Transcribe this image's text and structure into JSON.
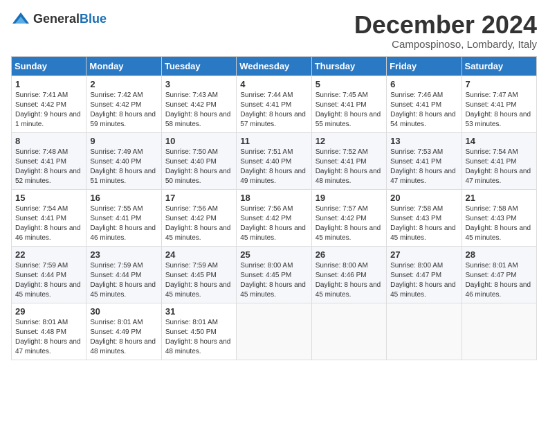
{
  "logo": {
    "general": "General",
    "blue": "Blue"
  },
  "header": {
    "month": "December 2024",
    "location": "Campospinoso, Lombardy, Italy"
  },
  "weekdays": [
    "Sunday",
    "Monday",
    "Tuesday",
    "Wednesday",
    "Thursday",
    "Friday",
    "Saturday"
  ],
  "weeks": [
    [
      {
        "day": "1",
        "sunrise": "Sunrise: 7:41 AM",
        "sunset": "Sunset: 4:42 PM",
        "daylight": "Daylight: 9 hours and 1 minute."
      },
      {
        "day": "2",
        "sunrise": "Sunrise: 7:42 AM",
        "sunset": "Sunset: 4:42 PM",
        "daylight": "Daylight: 8 hours and 59 minutes."
      },
      {
        "day": "3",
        "sunrise": "Sunrise: 7:43 AM",
        "sunset": "Sunset: 4:42 PM",
        "daylight": "Daylight: 8 hours and 58 minutes."
      },
      {
        "day": "4",
        "sunrise": "Sunrise: 7:44 AM",
        "sunset": "Sunset: 4:41 PM",
        "daylight": "Daylight: 8 hours and 57 minutes."
      },
      {
        "day": "5",
        "sunrise": "Sunrise: 7:45 AM",
        "sunset": "Sunset: 4:41 PM",
        "daylight": "Daylight: 8 hours and 55 minutes."
      },
      {
        "day": "6",
        "sunrise": "Sunrise: 7:46 AM",
        "sunset": "Sunset: 4:41 PM",
        "daylight": "Daylight: 8 hours and 54 minutes."
      },
      {
        "day": "7",
        "sunrise": "Sunrise: 7:47 AM",
        "sunset": "Sunset: 4:41 PM",
        "daylight": "Daylight: 8 hours and 53 minutes."
      }
    ],
    [
      {
        "day": "8",
        "sunrise": "Sunrise: 7:48 AM",
        "sunset": "Sunset: 4:41 PM",
        "daylight": "Daylight: 8 hours and 52 minutes."
      },
      {
        "day": "9",
        "sunrise": "Sunrise: 7:49 AM",
        "sunset": "Sunset: 4:40 PM",
        "daylight": "Daylight: 8 hours and 51 minutes."
      },
      {
        "day": "10",
        "sunrise": "Sunrise: 7:50 AM",
        "sunset": "Sunset: 4:40 PM",
        "daylight": "Daylight: 8 hours and 50 minutes."
      },
      {
        "day": "11",
        "sunrise": "Sunrise: 7:51 AM",
        "sunset": "Sunset: 4:40 PM",
        "daylight": "Daylight: 8 hours and 49 minutes."
      },
      {
        "day": "12",
        "sunrise": "Sunrise: 7:52 AM",
        "sunset": "Sunset: 4:41 PM",
        "daylight": "Daylight: 8 hours and 48 minutes."
      },
      {
        "day": "13",
        "sunrise": "Sunrise: 7:53 AM",
        "sunset": "Sunset: 4:41 PM",
        "daylight": "Daylight: 8 hours and 47 minutes."
      },
      {
        "day": "14",
        "sunrise": "Sunrise: 7:54 AM",
        "sunset": "Sunset: 4:41 PM",
        "daylight": "Daylight: 8 hours and 47 minutes."
      }
    ],
    [
      {
        "day": "15",
        "sunrise": "Sunrise: 7:54 AM",
        "sunset": "Sunset: 4:41 PM",
        "daylight": "Daylight: 8 hours and 46 minutes."
      },
      {
        "day": "16",
        "sunrise": "Sunrise: 7:55 AM",
        "sunset": "Sunset: 4:41 PM",
        "daylight": "Daylight: 8 hours and 46 minutes."
      },
      {
        "day": "17",
        "sunrise": "Sunrise: 7:56 AM",
        "sunset": "Sunset: 4:42 PM",
        "daylight": "Daylight: 8 hours and 45 minutes."
      },
      {
        "day": "18",
        "sunrise": "Sunrise: 7:56 AM",
        "sunset": "Sunset: 4:42 PM",
        "daylight": "Daylight: 8 hours and 45 minutes."
      },
      {
        "day": "19",
        "sunrise": "Sunrise: 7:57 AM",
        "sunset": "Sunset: 4:42 PM",
        "daylight": "Daylight: 8 hours and 45 minutes."
      },
      {
        "day": "20",
        "sunrise": "Sunrise: 7:58 AM",
        "sunset": "Sunset: 4:43 PM",
        "daylight": "Daylight: 8 hours and 45 minutes."
      },
      {
        "day": "21",
        "sunrise": "Sunrise: 7:58 AM",
        "sunset": "Sunset: 4:43 PM",
        "daylight": "Daylight: 8 hours and 45 minutes."
      }
    ],
    [
      {
        "day": "22",
        "sunrise": "Sunrise: 7:59 AM",
        "sunset": "Sunset: 4:44 PM",
        "daylight": "Daylight: 8 hours and 45 minutes."
      },
      {
        "day": "23",
        "sunrise": "Sunrise: 7:59 AM",
        "sunset": "Sunset: 4:44 PM",
        "daylight": "Daylight: 8 hours and 45 minutes."
      },
      {
        "day": "24",
        "sunrise": "Sunrise: 7:59 AM",
        "sunset": "Sunset: 4:45 PM",
        "daylight": "Daylight: 8 hours and 45 minutes."
      },
      {
        "day": "25",
        "sunrise": "Sunrise: 8:00 AM",
        "sunset": "Sunset: 4:45 PM",
        "daylight": "Daylight: 8 hours and 45 minutes."
      },
      {
        "day": "26",
        "sunrise": "Sunrise: 8:00 AM",
        "sunset": "Sunset: 4:46 PM",
        "daylight": "Daylight: 8 hours and 45 minutes."
      },
      {
        "day": "27",
        "sunrise": "Sunrise: 8:00 AM",
        "sunset": "Sunset: 4:47 PM",
        "daylight": "Daylight: 8 hours and 45 minutes."
      },
      {
        "day": "28",
        "sunrise": "Sunrise: 8:01 AM",
        "sunset": "Sunset: 4:47 PM",
        "daylight": "Daylight: 8 hours and 46 minutes."
      }
    ],
    [
      {
        "day": "29",
        "sunrise": "Sunrise: 8:01 AM",
        "sunset": "Sunset: 4:48 PM",
        "daylight": "Daylight: 8 hours and 47 minutes."
      },
      {
        "day": "30",
        "sunrise": "Sunrise: 8:01 AM",
        "sunset": "Sunset: 4:49 PM",
        "daylight": "Daylight: 8 hours and 48 minutes."
      },
      {
        "day": "31",
        "sunrise": "Sunrise: 8:01 AM",
        "sunset": "Sunset: 4:50 PM",
        "daylight": "Daylight: 8 hours and 48 minutes."
      },
      null,
      null,
      null,
      null
    ]
  ]
}
